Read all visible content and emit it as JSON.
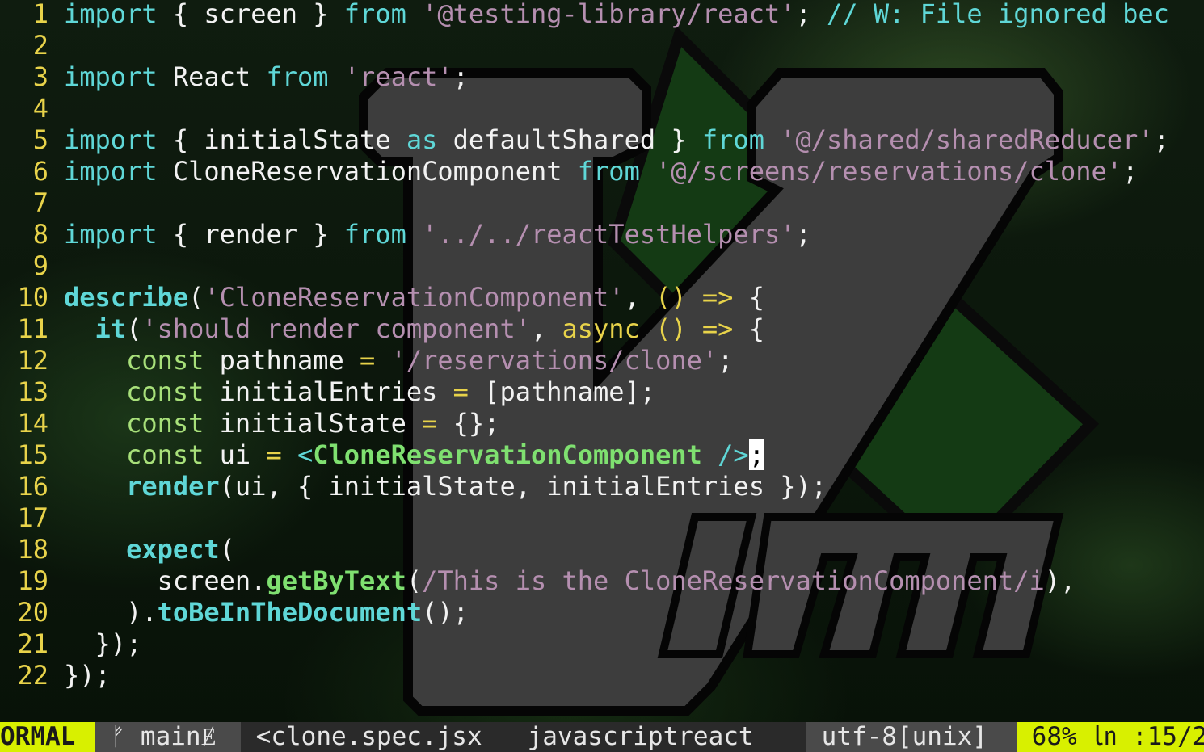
{
  "editor": {
    "lines": [
      {
        "num": "1",
        "html": "<span class=\"kw\">import</span> { screen } <span class=\"kw\">from</span> <span class=\"str\">'@testing-library/react'</span>; <span class=\"comment\">// W: File ignored bec</span>"
      },
      {
        "num": "2",
        "html": ""
      },
      {
        "num": "3",
        "html": "<span class=\"kw\">import</span> React <span class=\"kw\">from</span> <span class=\"str\">'react'</span>;"
      },
      {
        "num": "4",
        "html": ""
      },
      {
        "num": "5",
        "html": "<span class=\"kw\">import</span> { initialState <span class=\"kw\">as</span> defaultShared } <span class=\"kw\">from</span> <span class=\"str\">'@/shared/sharedReducer'</span>;"
      },
      {
        "num": "6",
        "html": "<span class=\"kw\">import</span> CloneReservationComponent <span class=\"kw\">from</span> <span class=\"str\">'@/screens/reservations/clone'</span>;"
      },
      {
        "num": "7",
        "html": ""
      },
      {
        "num": "8",
        "html": "<span class=\"kw\">import</span> { render } <span class=\"kw\">from</span> <span class=\"str\">'../../reactTestHelpers'</span>;"
      },
      {
        "num": "9",
        "html": ""
      },
      {
        "num": "10",
        "html": "<span class=\"fn\">describe</span>(<span class=\"str\">'CloneReservationComponent'</span>, <span class=\"op\">()</span> <span class=\"op\">=&gt;</span> {"
      },
      {
        "num": "11",
        "html": "  <span class=\"fn\">it</span>(<span class=\"str\">'should render component'</span>, <span class=\"async\">async</span> <span class=\"op\">()</span> <span class=\"op\">=&gt;</span> {"
      },
      {
        "num": "12",
        "html": "    <span class=\"decl\">const</span> pathname <span class=\"op\">=</span> <span class=\"str\">'/reservations/clone'</span>;"
      },
      {
        "num": "13",
        "html": "    <span class=\"decl\">const</span> initialEntries <span class=\"op\">=</span> [pathname];"
      },
      {
        "num": "14",
        "html": "    <span class=\"decl\">const</span> initialState <span class=\"op\">=</span> {};"
      },
      {
        "num": "15",
        "html": "    <span class=\"decl\">const</span> ui <span class=\"op\">=</span> <span class=\"tag\">&lt;</span><span class=\"jsx\">CloneReservationComponent</span> <span class=\"tag\">/&gt;</span><span class=\"cursor\">;</span>"
      },
      {
        "num": "16",
        "html": "    <span class=\"fn\">render</span>(ui, { initialState, initialEntries });"
      },
      {
        "num": "17",
        "html": ""
      },
      {
        "num": "18",
        "html": "    <span class=\"fn\">expect</span>("
      },
      {
        "num": "19",
        "html": "      screen.<span class=\"method\">getByText</span>(<span class=\"regex\">/This is the CloneReservationComponent/i</span>),"
      },
      {
        "num": "20",
        "html": "    ).<span class=\"fn\">toBeInTheDocument</span>();"
      },
      {
        "num": "21",
        "html": "  });"
      },
      {
        "num": "22",
        "html": "});"
      }
    ]
  },
  "statusbar": {
    "mode": "ORMAL",
    "branch": " ᚠ main",
    "branch_icon": "Ɇ",
    "filename": " <clone.spec.jsx",
    "filetype": "javascriptreact",
    "encoding": " utf-8[unix]",
    "position": " 68% ㏑ :15/2"
  },
  "colors": {
    "accent": "#d8f000",
    "line_numbers": "#e8d34a",
    "keywords": "#5fd7d7",
    "strings": "#b58fb0"
  }
}
